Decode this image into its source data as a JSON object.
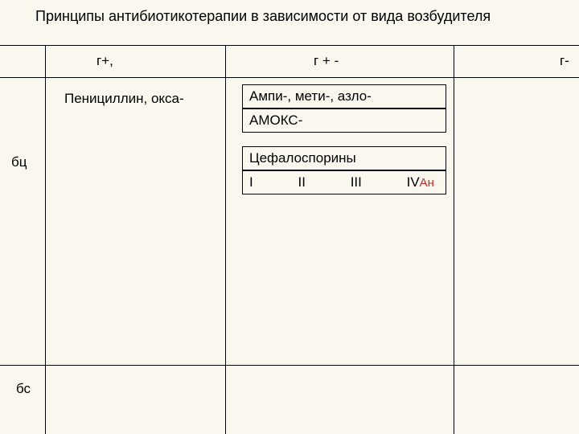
{
  "title": "Принципы антибиотикотерапии в зависимости от вида возбудителя",
  "header": {
    "left": "г+,",
    "mid": "г + -",
    "right": "г-"
  },
  "sideLabels": {
    "bc": "бц",
    "bs": "бс"
  },
  "leftCell": {
    "text": "Пенициллин, окса-"
  },
  "boxes": {
    "b1": "Ампи-, мети-, азло-",
    "b2": "АМОКС-",
    "b3": "Цефалоспорины",
    "romans": {
      "r1": "I",
      "r2": "II",
      "r3": "III",
      "r4": "IV",
      "r4suffix": "Ан"
    }
  }
}
